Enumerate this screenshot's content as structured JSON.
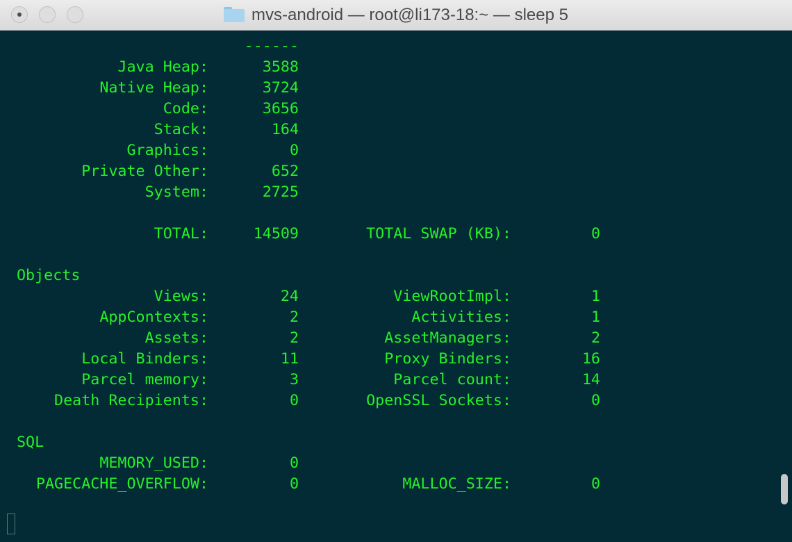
{
  "window": {
    "title": "mvs-android — root@li173-18:~ — sleep 5",
    "folder_icon": "folder-icon"
  },
  "colors": {
    "terminal_bg": "#022b35",
    "terminal_fg": "#28f028"
  },
  "terminal": {
    "separator": "------",
    "memory": [
      {
        "label": "Java Heap:",
        "value": "3588"
      },
      {
        "label": "Native Heap:",
        "value": "3724"
      },
      {
        "label": "Code:",
        "value": "3656"
      },
      {
        "label": "Stack:",
        "value": "164"
      },
      {
        "label": "Graphics:",
        "value": "0"
      },
      {
        "label": "Private Other:",
        "value": "652"
      },
      {
        "label": "System:",
        "value": "2725"
      }
    ],
    "total": {
      "label": "TOTAL:",
      "value": "14509",
      "label2": "TOTAL SWAP (KB):",
      "value2": "0"
    },
    "objects_heading": "Objects",
    "objects": [
      {
        "label": "Views:",
        "value": "24",
        "label2": "ViewRootImpl:",
        "value2": "1"
      },
      {
        "label": "AppContexts:",
        "value": "2",
        "label2": "Activities:",
        "value2": "1"
      },
      {
        "label": "Assets:",
        "value": "2",
        "label2": "AssetManagers:",
        "value2": "2"
      },
      {
        "label": "Local Binders:",
        "value": "11",
        "label2": "Proxy Binders:",
        "value2": "16"
      },
      {
        "label": "Parcel memory:",
        "value": "3",
        "label2": "Parcel count:",
        "value2": "14"
      },
      {
        "label": "Death Recipients:",
        "value": "0",
        "label2": "OpenSSL Sockets:",
        "value2": "0"
      }
    ],
    "sql_heading": "SQL",
    "sql": [
      {
        "label": "MEMORY_USED:",
        "value": "0"
      },
      {
        "label": "PAGECACHE_OVERFLOW:",
        "value": "0",
        "label2": "MALLOC_SIZE:",
        "value2": "0"
      }
    ]
  }
}
